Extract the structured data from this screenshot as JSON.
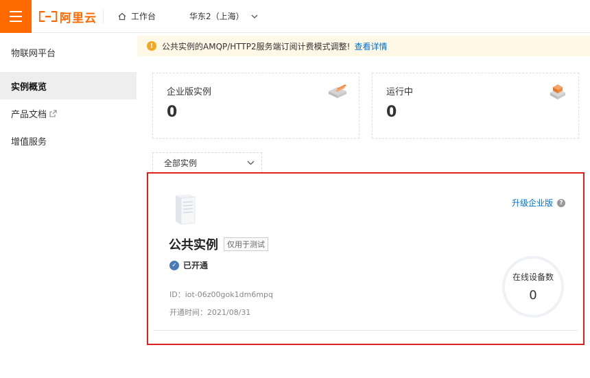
{
  "header": {
    "brand": "阿里云",
    "workbench": "工作台",
    "region": "华东2（上海）"
  },
  "sidebar": {
    "title": "物联网平台",
    "items": [
      {
        "label": "实例概览",
        "active": true
      },
      {
        "label": "产品文档",
        "external": true
      },
      {
        "label": "增值服务"
      }
    ]
  },
  "notice": {
    "text": "公共实例的AMQP/HTTP2服务端订阅计费模式调整!",
    "link": "查看详情"
  },
  "stats": [
    {
      "label": "企业版实例",
      "value": "0",
      "icon": "stack-icon"
    },
    {
      "label": "运行中",
      "value": "0",
      "icon": "cube-icon"
    }
  ],
  "filter": {
    "selected": "全部实例"
  },
  "instance": {
    "upgrade_label": "升级企业版",
    "name": "公共实例",
    "tag": "仅用于测试",
    "status": "已开通",
    "id_line": "ID：iot-06z00gok1dm6mpq",
    "opened_line": "开通时间：2021/08/31",
    "online_label": "在线设备数",
    "online_count": "0"
  },
  "colors": {
    "brand": "#ff6a00",
    "link": "#0070cc",
    "highlight_border": "#e0201a"
  }
}
